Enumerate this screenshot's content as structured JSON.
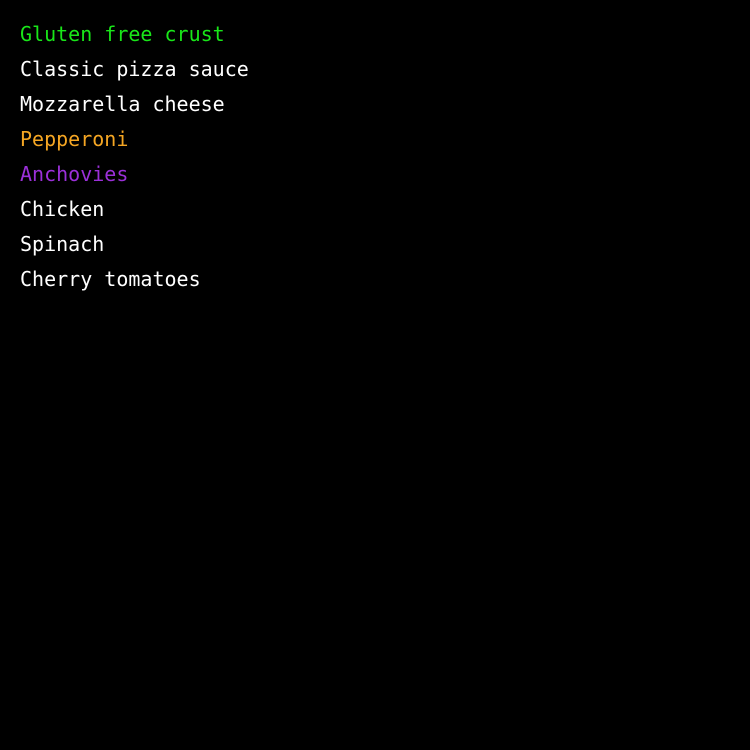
{
  "toppings": {
    "items": [
      {
        "label": "Gluten free crust",
        "color": "#19e619"
      },
      {
        "label": "Classic pizza sauce",
        "color": "#ffffff"
      },
      {
        "label": "Mozzarella cheese",
        "color": "#ffffff"
      },
      {
        "label": "Pepperoni",
        "color": "#f5a623"
      },
      {
        "label": "Anchovies",
        "color": "#9b30d9"
      },
      {
        "label": "Chicken",
        "color": "#ffffff"
      },
      {
        "label": "Spinach",
        "color": "#ffffff"
      },
      {
        "label": "Cherry tomatoes",
        "color": "#ffffff"
      }
    ]
  }
}
